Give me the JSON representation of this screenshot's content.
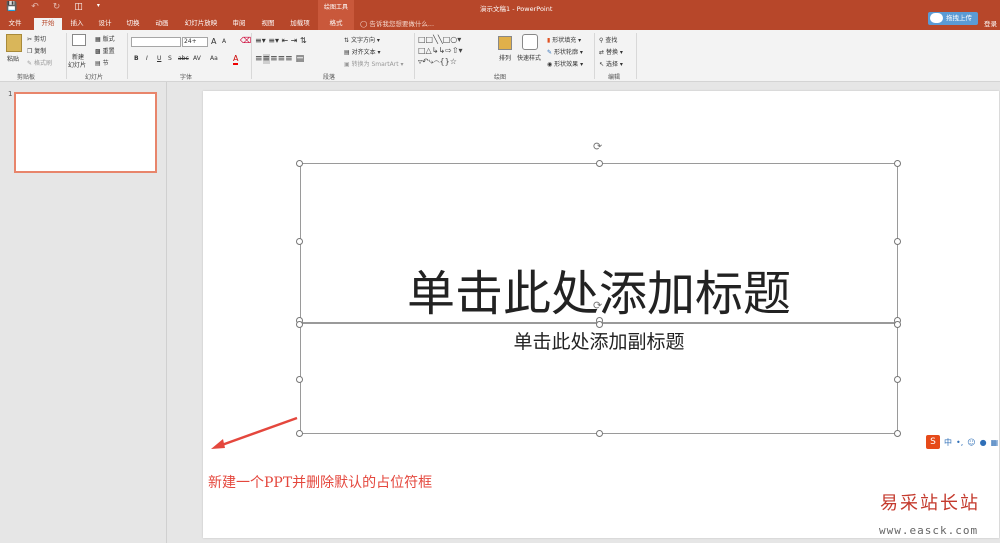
{
  "title_bar": {
    "context_tools": "绘图工具",
    "document_title": "演示文稿1 - PowerPoint"
  },
  "tabs": {
    "file": "文件",
    "home": "开始",
    "insert": "插入",
    "design": "设计",
    "transitions": "切换",
    "animations": "动画",
    "slideshow": "幻灯片放映",
    "review": "审阅",
    "view": "视图",
    "addins": "加载项",
    "format": "格式",
    "tell_me": "告诉我您想要做什么..."
  },
  "account": {
    "upload": "拖拽上传",
    "login": "登录"
  },
  "ribbon": {
    "clipboard": {
      "paste": "粘贴",
      "cut": "剪切",
      "copy": "复制",
      "format_painter": "格式刷",
      "group": "剪贴板"
    },
    "slides": {
      "new_slide_1": "新建",
      "new_slide_2": "幻灯片",
      "layout": "版式",
      "reset": "重置",
      "section": "节",
      "group": "幻灯片"
    },
    "font": {
      "font_name": "",
      "font_size": "24+",
      "bold": "B",
      "italic": "I",
      "underline": "U",
      "strike": "S",
      "abc": "abc",
      "spacing": "AV",
      "case": "Aa",
      "grow": "A",
      "shrink": "A",
      "font_color": "A",
      "group": "字体"
    },
    "paragraph": {
      "text_direction": "文字方向",
      "align_text": "对齐文本",
      "smartart": "转换为 SmartArt",
      "group": "段落"
    },
    "drawing": {
      "arrange": "排列",
      "quick_styles": "快速样式",
      "shape_fill": "形状填充",
      "shape_outline": "形状轮廓",
      "shape_effects": "形状效果",
      "group": "绘图"
    },
    "editing": {
      "find": "查找",
      "replace": "替换",
      "select": "选择",
      "group": "编辑"
    }
  },
  "slide_panel": {
    "slide_number": "1"
  },
  "slide": {
    "title_placeholder": "单击此处添加标题",
    "subtitle_placeholder": "单击此处添加副标题"
  },
  "annotation": "新建一个PPT并删除默认的占位符框",
  "ime": {
    "logo": "S",
    "lang": "中"
  },
  "watermark": {
    "name": "易采站长站",
    "url": "www.easck.com"
  },
  "colors": {
    "accent": "#b7472a",
    "annotation": "#e4473d",
    "thumb_border": "#e8856b"
  }
}
